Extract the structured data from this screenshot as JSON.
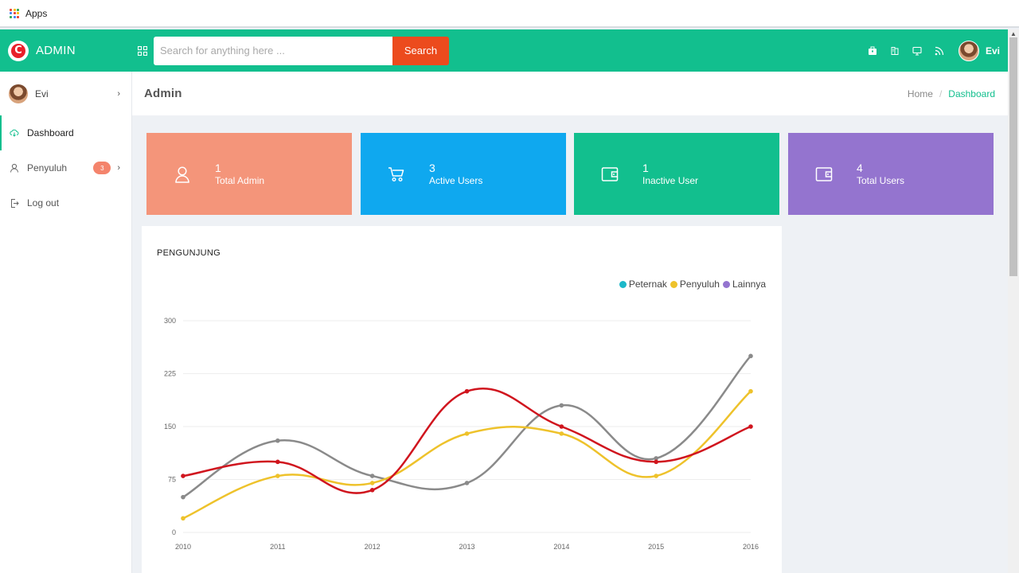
{
  "browser": {
    "bookmark_apps": "Apps"
  },
  "header": {
    "brand": "ADMIN",
    "logo_letter": "C",
    "search_placeholder": "Search for anything here ...",
    "search_button": "Search",
    "user_name": "Evi",
    "colors": {
      "bar": "#12bf8e",
      "search_button": "#ec4b1d"
    }
  },
  "sidebar": {
    "user_name": "Evi",
    "items": [
      {
        "label": "Dashboard",
        "icon": "cloud-icon"
      },
      {
        "label": "Penyuluh",
        "icon": "user-icon",
        "badge": "3"
      },
      {
        "label": "Log out",
        "icon": "logout-icon"
      }
    ]
  },
  "page": {
    "title": "Admin",
    "breadcrumb": {
      "home": "Home",
      "separator": "/",
      "current": "Dashboard"
    }
  },
  "cards": [
    {
      "number": "1",
      "label": "Total Admin",
      "icon": "user-icon",
      "color": "#f4957a"
    },
    {
      "number": "3",
      "label": "Active Users",
      "icon": "cart-icon",
      "color": "#0fa8ef"
    },
    {
      "number": "1",
      "label": "Inactive User",
      "icon": "wallet-icon",
      "color": "#12bf8e"
    },
    {
      "number": "4",
      "label": "Total Users",
      "icon": "wallet-icon",
      "color": "#9474cf"
    }
  ],
  "chart_title": "PENGUNJUNG",
  "legend": [
    {
      "name": "Peternak",
      "color": "#1cb8c9"
    },
    {
      "name": "Penyuluh",
      "color": "#eec22b"
    },
    {
      "name": "Lainnya",
      "color": "#9474cf"
    }
  ],
  "chart_data": {
    "type": "line",
    "x": [
      "2010",
      "2011",
      "2012",
      "2013",
      "2014",
      "2015",
      "2016"
    ],
    "ylim": [
      0,
      300
    ],
    "yticks": [
      "0",
      "75",
      "150",
      "225",
      "300"
    ],
    "grid": true,
    "smooth": true,
    "series": [
      {
        "values": [
          50,
          130,
          80,
          70,
          180,
          105,
          250
        ],
        "color": "#8a8a8a"
      },
      {
        "values": [
          20,
          80,
          70,
          140,
          140,
          80,
          200
        ],
        "color": "#eec22b"
      },
      {
        "values": [
          80,
          100,
          60,
          200,
          150,
          100,
          150
        ],
        "color": "#d0151e"
      }
    ]
  }
}
